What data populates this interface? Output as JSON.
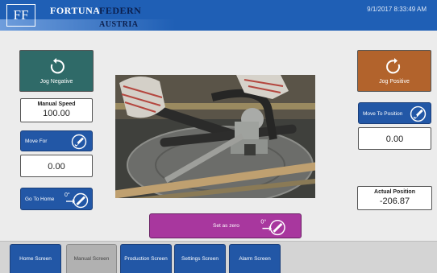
{
  "header": {
    "logo": "FF",
    "brand_first": "FORTUNA",
    "brand_second": "FEDERN",
    "brand_third": "AUSTRIA",
    "datetime": "9/1/2017 8:33:49 AM"
  },
  "jog": {
    "negative_label": "Jog Negative",
    "positive_label": "Jog Positive"
  },
  "manual_speed": {
    "caption": "Manual Speed",
    "value": "100.00"
  },
  "move_for": {
    "label": "Move For",
    "value": "0.00"
  },
  "go_to_home": {
    "label": "Go To Home"
  },
  "move_to_position": {
    "label": "Move To Position",
    "value": "0.00"
  },
  "actual_position": {
    "caption": "Actual Position",
    "value": "-206.87"
  },
  "set_as_zero": {
    "label": "Set as zero"
  },
  "icons": {
    "zero_marker": "0°",
    "jog_negative": "rotate-ccw-icon",
    "jog_positive": "rotate-cw-icon",
    "move": "dial-icon"
  },
  "nav": [
    {
      "label": "Home Screen",
      "active": false
    },
    {
      "label": "Manual Screen",
      "active": true
    },
    {
      "label": "Production Screen",
      "active": false
    },
    {
      "label": "Settings Screen",
      "active": false
    },
    {
      "label": "Alarm Screen",
      "active": false
    }
  ],
  "colors": {
    "header_blue": "#1f5fb5",
    "button_blue": "#2257a6",
    "jog_negative": "#2f6a68",
    "jog_positive": "#b2632c",
    "set_zero": "#a8379e",
    "nav_active": "#b1b1b1"
  }
}
